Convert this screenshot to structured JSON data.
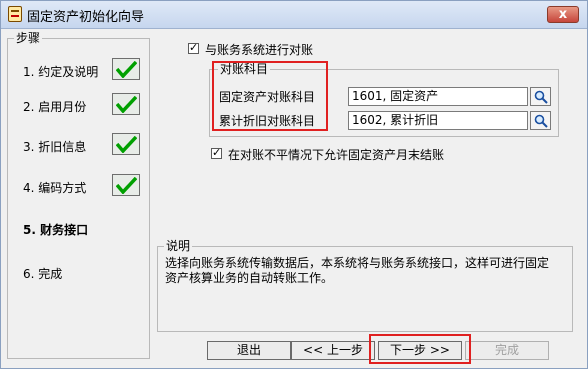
{
  "window": {
    "title": "固定资产初始化向导",
    "close_glyph": "x"
  },
  "steps": {
    "group_title": "步骤",
    "items": [
      {
        "label": "1. 约定及说明",
        "done": true
      },
      {
        "label": "2. 启用月份",
        "done": true
      },
      {
        "label": "3. 折旧信息",
        "done": true
      },
      {
        "label": "4. 编码方式",
        "done": true
      },
      {
        "label": "5. 财务接口",
        "done": false,
        "current": true
      },
      {
        "label": "6. 完成",
        "done": false
      }
    ],
    "check_color": "#00a000"
  },
  "interface": {
    "reconcile_checkbox": {
      "label": "与账务系统进行对账",
      "checked": true
    },
    "accounts_group_title": "对账科目",
    "fixed_asset_account": {
      "label": "固定资产对账科目",
      "value": "1601, 固定资产",
      "lookup_icon": "magnifier-icon"
    },
    "depreciation_account": {
      "label": "累计折旧对账科目",
      "value": "1602, 累计折旧",
      "lookup_icon": "magnifier-icon"
    },
    "allow_close_checkbox": {
      "label": "在对账不平情况下允许固定资产月末结账",
      "checked": true
    }
  },
  "description": {
    "group_title": "说明",
    "text": "选择向账务系统传输数据后，本系统将与账务系统接口，这样可进行固定资产核算业务的自动转账工作。"
  },
  "buttons": {
    "exit": "退出",
    "prev": "<< 上一步",
    "next": "下一步 >>",
    "finish": "完成"
  },
  "highlight_color": "#e02020"
}
